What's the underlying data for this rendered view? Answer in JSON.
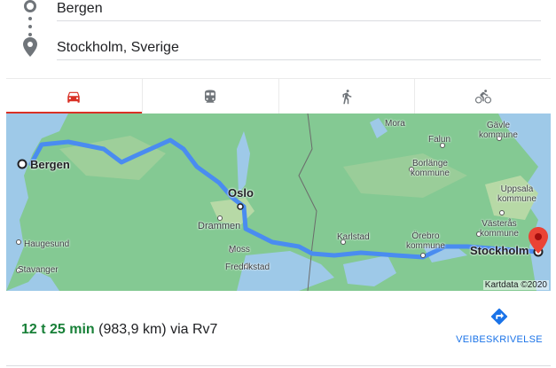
{
  "route": {
    "origin": "Bergen",
    "destination": "Stockholm, Sverige"
  },
  "modes": [
    {
      "name": "car",
      "icon": "car-icon",
      "active": true
    },
    {
      "name": "transit",
      "icon": "transit-icon",
      "active": false
    },
    {
      "name": "walking",
      "icon": "walking-icon",
      "active": false
    },
    {
      "name": "cycling",
      "icon": "bicycle-icon",
      "active": false
    }
  ],
  "map": {
    "places": {
      "bergen": "Bergen",
      "oslo": "Oslo",
      "stockholm": "Stockholm",
      "drammen": "Drammen",
      "moss": "Moss",
      "fredrikstad": "Fredrikstad",
      "haugesund": "Haugesund",
      "stavanger": "Stavanger",
      "karlstad": "Karlstad",
      "orebro": "Örebro",
      "orebro2": "kommune",
      "vasteras": "Västerås",
      "vasteras2": "kommune",
      "uppsala": "Uppsala",
      "uppsala2": "kommune",
      "mora": "Mora",
      "falun": "Falun",
      "borlange": "Borlänge",
      "borlange2": "kommune",
      "gavle": "Gävle",
      "gavle2": "kommune"
    },
    "attribution": "Kartdata ©2020"
  },
  "summary": {
    "duration": "12 t 25 min",
    "distance": "(983,9 km)",
    "via": "via Rv7"
  },
  "directions_label": "VEIBESKRIVELSE",
  "colors": {
    "accent_red": "#d93025",
    "duration_green": "#188038",
    "link_blue": "#1a73e8",
    "route_blue": "#4a8cf0"
  }
}
